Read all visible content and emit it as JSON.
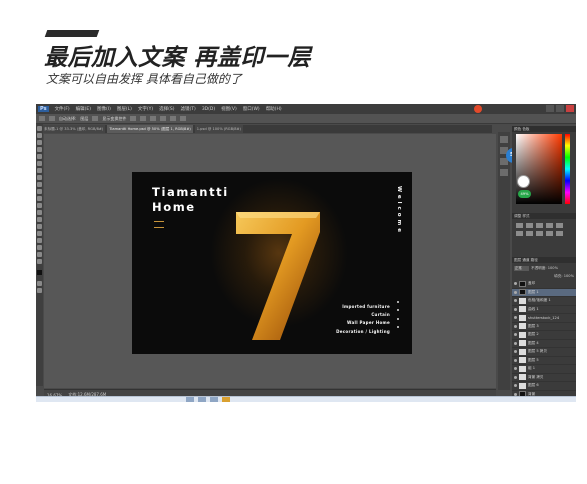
{
  "header": {
    "title": "最后加入文案 再盖印一层",
    "subtitle": "文案可以自由发挥 具体看自己做的了"
  },
  "photoshop": {
    "app_logo": "Ps",
    "menus": [
      "文件(F)",
      "编辑(E)",
      "图像(I)",
      "图层(L)",
      "文字(Y)",
      "选择(S)",
      "滤镜(T)",
      "3D(D)",
      "视图(V)",
      "窗口(W)",
      "帮助(H)"
    ],
    "options_bar": [
      "自动选择:",
      "图层",
      "显示变换控件"
    ],
    "tabs": [
      {
        "label": "未标题-1 @ 33.3% (盖印, RGB/8#)",
        "active": false
      },
      {
        "label": "Tiamantti Home.psd @ 50% (图层 1, RGB/8#)",
        "active": true
      },
      {
        "label": "1.psd @ 100% (RGB/8#)",
        "active": false
      }
    ],
    "status": {
      "zoom": "16.67%",
      "doc_size": "文档:12.6M/287.6M"
    },
    "canvas": {
      "brand_line1": "Tiamantti",
      "brand_line2": "Home",
      "big_number": "7",
      "vertical_text": "Welcome",
      "menu_items": [
        "Imported furniture",
        "Curtain",
        "Wall  Paper Home",
        "Decoration / Lighting"
      ]
    },
    "avatar_text": "58",
    "color_badge": "49%",
    "panels": {
      "color_title": "颜色  色板",
      "adjust_title": "调整  样式",
      "layers_title": "图层  通道  路径",
      "blend_mode": "正常",
      "opacity_label": "不透明度: 100%",
      "fill_label": "填充: 100%"
    },
    "layers": [
      {
        "name": "盖印",
        "thumb": "dark",
        "selected": false
      },
      {
        "name": "图层 1",
        "thumb": "dark",
        "selected": true
      },
      {
        "name": "色相/饱和度 1",
        "thumb": "light",
        "selected": false
      },
      {
        "name": "曲线 1",
        "thumb": "light",
        "selected": false
      },
      {
        "name": "shutterstock_124",
        "thumb": "light",
        "selected": false
      },
      {
        "name": "图层 3",
        "thumb": "light",
        "selected": false
      },
      {
        "name": "图层 2",
        "thumb": "light",
        "selected": false
      },
      {
        "name": "图层 4",
        "thumb": "light",
        "selected": false
      },
      {
        "name": "图层 5 拷贝",
        "thumb": "light",
        "selected": false
      },
      {
        "name": "图层 5",
        "thumb": "light",
        "selected": false
      },
      {
        "name": "组 1",
        "thumb": "light",
        "selected": false
      },
      {
        "name": "背景 拷贝",
        "thumb": "light",
        "selected": false
      },
      {
        "name": "图层 6",
        "thumb": "light",
        "selected": false
      },
      {
        "name": "背景",
        "thumb": "dark",
        "selected": false
      }
    ]
  },
  "colors": {
    "gold": "#d89a2a",
    "canvas_bg": "#0b0b0b",
    "ps_bg": "#4a4a4a"
  }
}
